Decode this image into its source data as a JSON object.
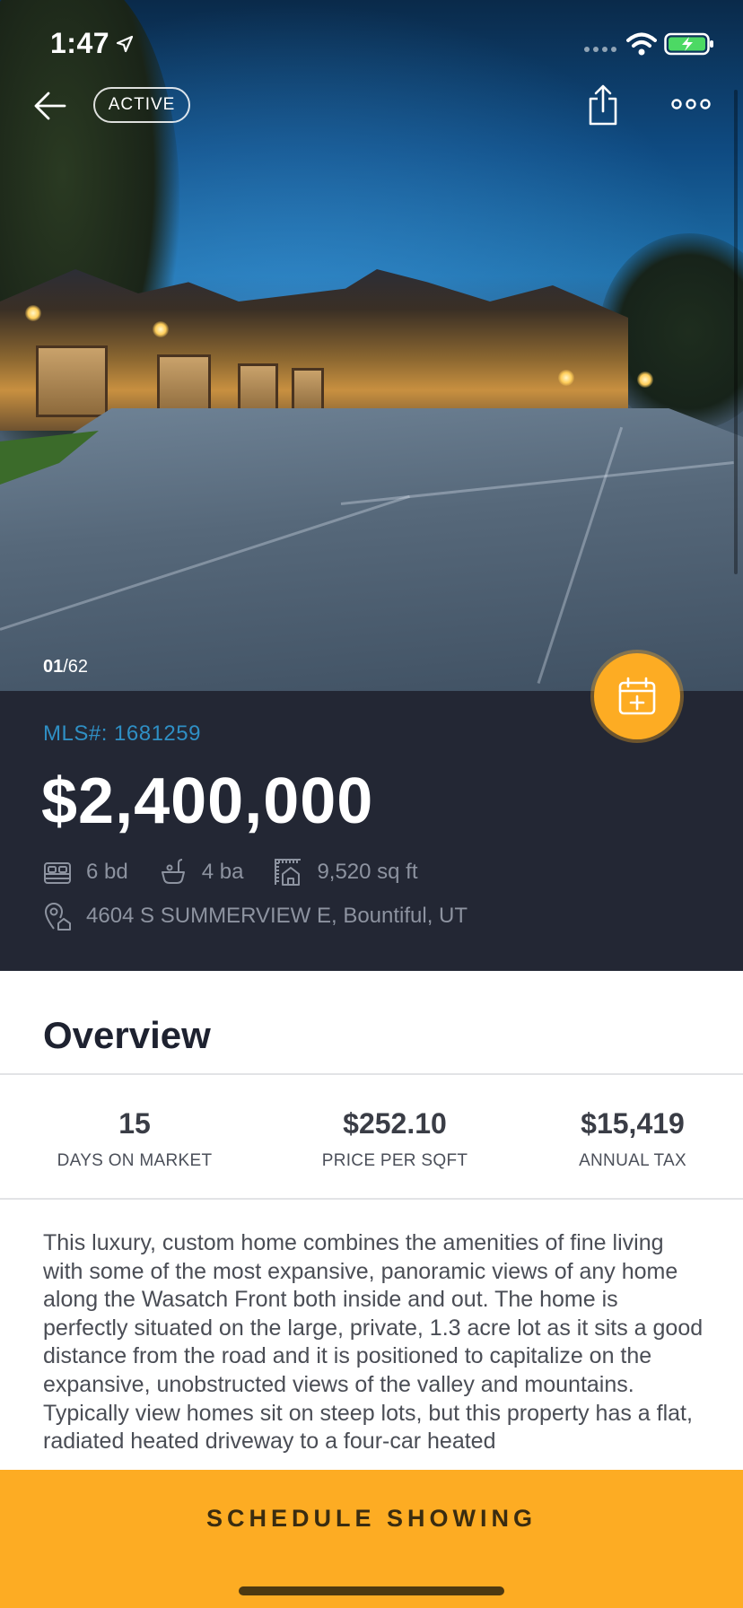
{
  "status_bar": {
    "time": "1:47"
  },
  "header": {
    "status_badge": "ACTIVE"
  },
  "photo": {
    "current": "01",
    "total_suffix": "/62"
  },
  "listing": {
    "mls": "MLS#: 1681259",
    "price": "$2,400,000",
    "beds": "6 bd",
    "baths": "4 ba",
    "area": "9,520 sq ft",
    "address": "4604 S SUMMERVIEW E, Bountiful, UT"
  },
  "overview": {
    "title": "Overview",
    "stats": [
      {
        "value": "15",
        "label": "DAYS ON MARKET"
      },
      {
        "value": "$252.10",
        "label": "PRICE PER SQFT"
      },
      {
        "value": "$15,419",
        "label": "ANNUAL TAX"
      }
    ],
    "description": "This luxury, custom home combines the amenities of fine living with some of the most expansive, panoramic views of any home along the Wasatch Front both inside and out. The home is perfectly situated on the large, private, 1.3 acre lot as it sits a good distance from the road and it is positioned to capitalize on the expansive, unobstructed views of the valley and mountains. Typically view homes sit on steep lots, but this property has a flat, radiated heated driveway to a four-car heated"
  },
  "cta": {
    "label": "SCHEDULE SHOWING"
  },
  "colors": {
    "accent": "#fdac23",
    "panel": "#232734",
    "mls_link": "#2f8fc4"
  }
}
